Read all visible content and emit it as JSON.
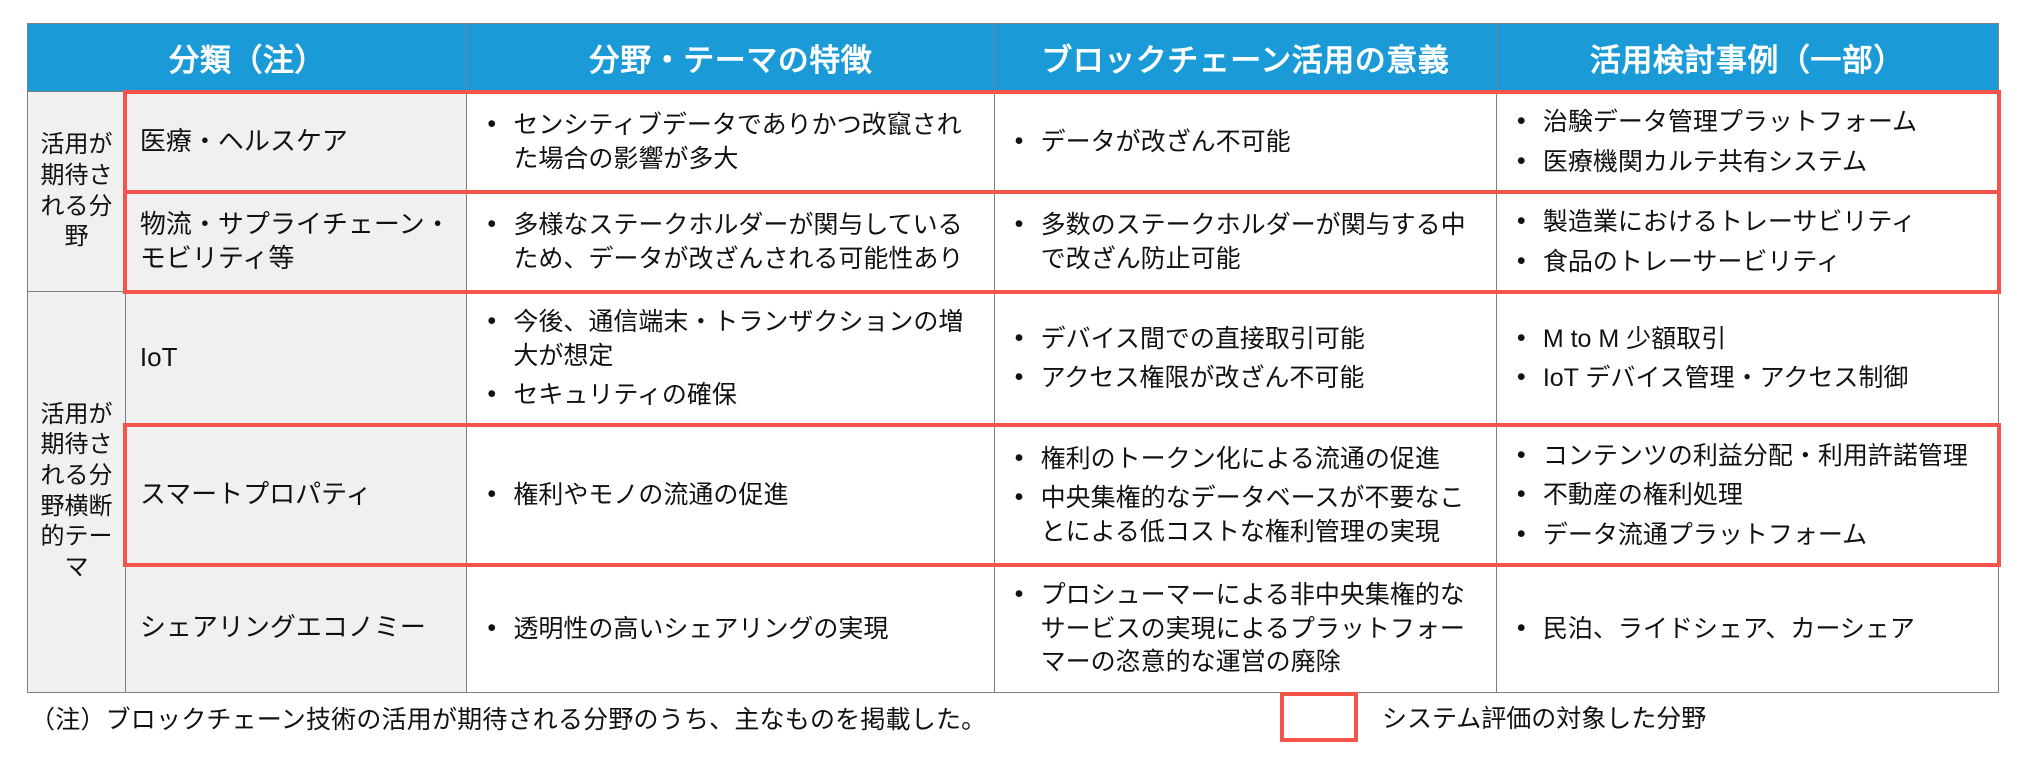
{
  "table": {
    "headers": [
      {
        "label": "分類（注）"
      },
      {
        "label": "分野・テーマの特徴"
      },
      {
        "label": "ブロックチェーン活用の意義"
      },
      {
        "label": "活用検討事例（一部）"
      }
    ],
    "groups": [
      {
        "label": "活用が期待される分野"
      },
      {
        "label": "活用が期待される分野横断的テーマ"
      }
    ],
    "rows": [
      {
        "category": "医療・ヘルスケア",
        "features": [
          "センシティブデータでありかつ改竄された場合の影響が多大"
        ],
        "significance": [
          "データが改ざん不可能"
        ],
        "cases": [
          "治験データ管理プラットフォーム",
          "医療機関カルテ共有システム"
        ],
        "highlighted": true
      },
      {
        "category": "物流・サプライチェーン・モビリティ等",
        "features": [
          "多様なステークホルダーが関与しているため、データが改ざんされる可能性あり"
        ],
        "significance": [
          "多数のステークホルダーが関与する中で改ざん防止可能"
        ],
        "cases": [
          "製造業におけるトレーサビリティ",
          "食品のトレーサービリティ"
        ],
        "highlighted": true
      },
      {
        "category": "IoT",
        "features": [
          "今後、通信端末・トランザクションの増大が想定",
          "セキュリティの確保"
        ],
        "significance": [
          "デバイス間での直接取引可能",
          "アクセス権限が改ざん不可能"
        ],
        "cases": [
          "M to M 少額取引",
          "IoT デバイス管理・アクセス制御"
        ],
        "highlighted": false
      },
      {
        "category": "スマートプロパティ",
        "features": [
          "権利やモノの流通の促進"
        ],
        "significance": [
          "権利のトークン化による流通の促進",
          "中央集権的なデータベースが不要なことによる低コストな権利管理の実現"
        ],
        "cases": [
          "コンテンツの利益分配・利用許諾管理",
          "不動産の権利処理",
          "データ流通プラットフォーム"
        ],
        "highlighted": true
      },
      {
        "category": "シェアリングエコノミー",
        "features": [
          "透明性の高いシェアリングの実現"
        ],
        "significance": [
          "プロシューマーによる非中央集権的なサービスの実現によるプラットフォーマーの恣意的な運営の廃除"
        ],
        "cases": [
          "民泊、ライドシェア、カーシェア"
        ],
        "highlighted": false
      }
    ]
  },
  "footer": {
    "note": "（注）ブロックチェーン技術の活用が期待される分野のうち、主なものを掲載した。",
    "legend_label": "システム評価の対象した分野"
  },
  "colors": {
    "header_blue": "#1a9bd7",
    "highlight_red": "#f4544c",
    "cell_gray": "#f0f0f0",
    "border_gray": "#808080"
  }
}
